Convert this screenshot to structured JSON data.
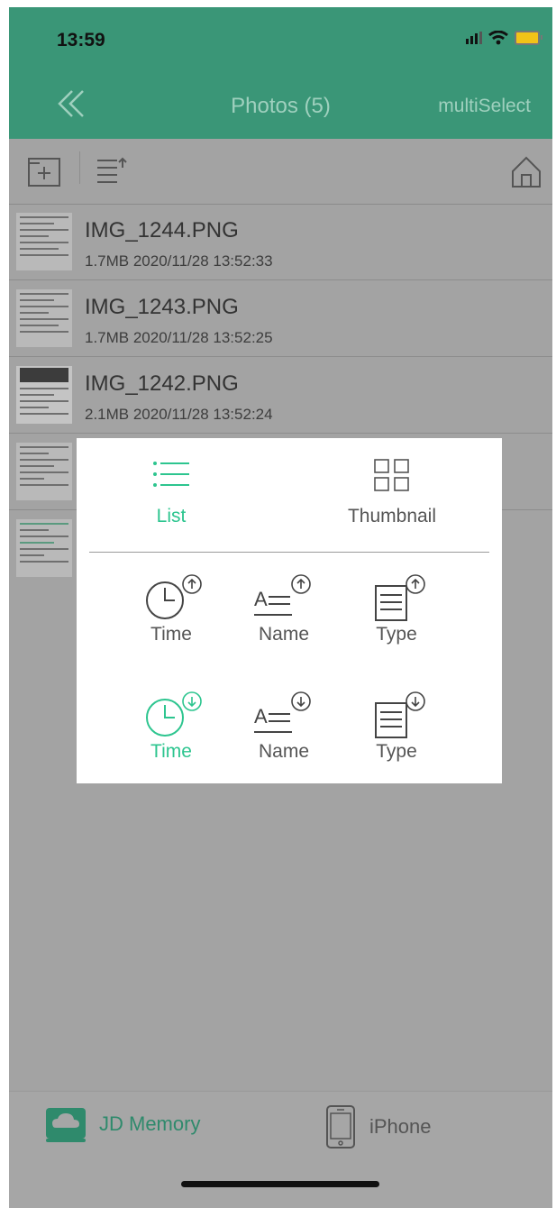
{
  "status": {
    "time": "13:59"
  },
  "nav": {
    "back_icon": "double-chevron-left-icon",
    "title": "Photos (5)",
    "action_label": "multiSelect"
  },
  "toolbar": {
    "new_folder_icon": "add-folder-icon",
    "sort_icon": "sort-list-icon",
    "home_icon": "home-icon"
  },
  "files": [
    {
      "name": "IMG_1244.PNG",
      "meta": "1.7MB 2020/11/28 13:52:33"
    },
    {
      "name": "IMG_1243.PNG",
      "meta": "1.7MB 2020/11/28 13:52:25"
    },
    {
      "name": "IMG_1242.PNG",
      "meta": "2.1MB 2020/11/28 13:52:24"
    }
  ],
  "popup": {
    "view_modes": [
      {
        "label": "List",
        "icon": "list-icon",
        "selected": true
      },
      {
        "label": "Thumbnail",
        "icon": "grid-icon",
        "selected": false
      }
    ],
    "sort_ascending": [
      {
        "label": "Time",
        "icon": "clock-icon",
        "selected": false
      },
      {
        "label": "Name",
        "icon": "name-sort-icon",
        "selected": false
      },
      {
        "label": "Type",
        "icon": "document-icon",
        "selected": false
      }
    ],
    "sort_descending": [
      {
        "label": "Time",
        "icon": "clock-icon",
        "selected": true
      },
      {
        "label": "Name",
        "icon": "name-sort-icon",
        "selected": false
      },
      {
        "label": "Type",
        "icon": "document-icon",
        "selected": false
      }
    ]
  },
  "tabs": [
    {
      "label": "JD Memory",
      "icon": "cloud-drive-icon",
      "active": true
    },
    {
      "label": "iPhone",
      "icon": "phone-icon",
      "active": false
    }
  ],
  "colors": {
    "accent": "#2dc58f",
    "header": "#3a9677",
    "overlay_gray": "#a3a3a3"
  }
}
